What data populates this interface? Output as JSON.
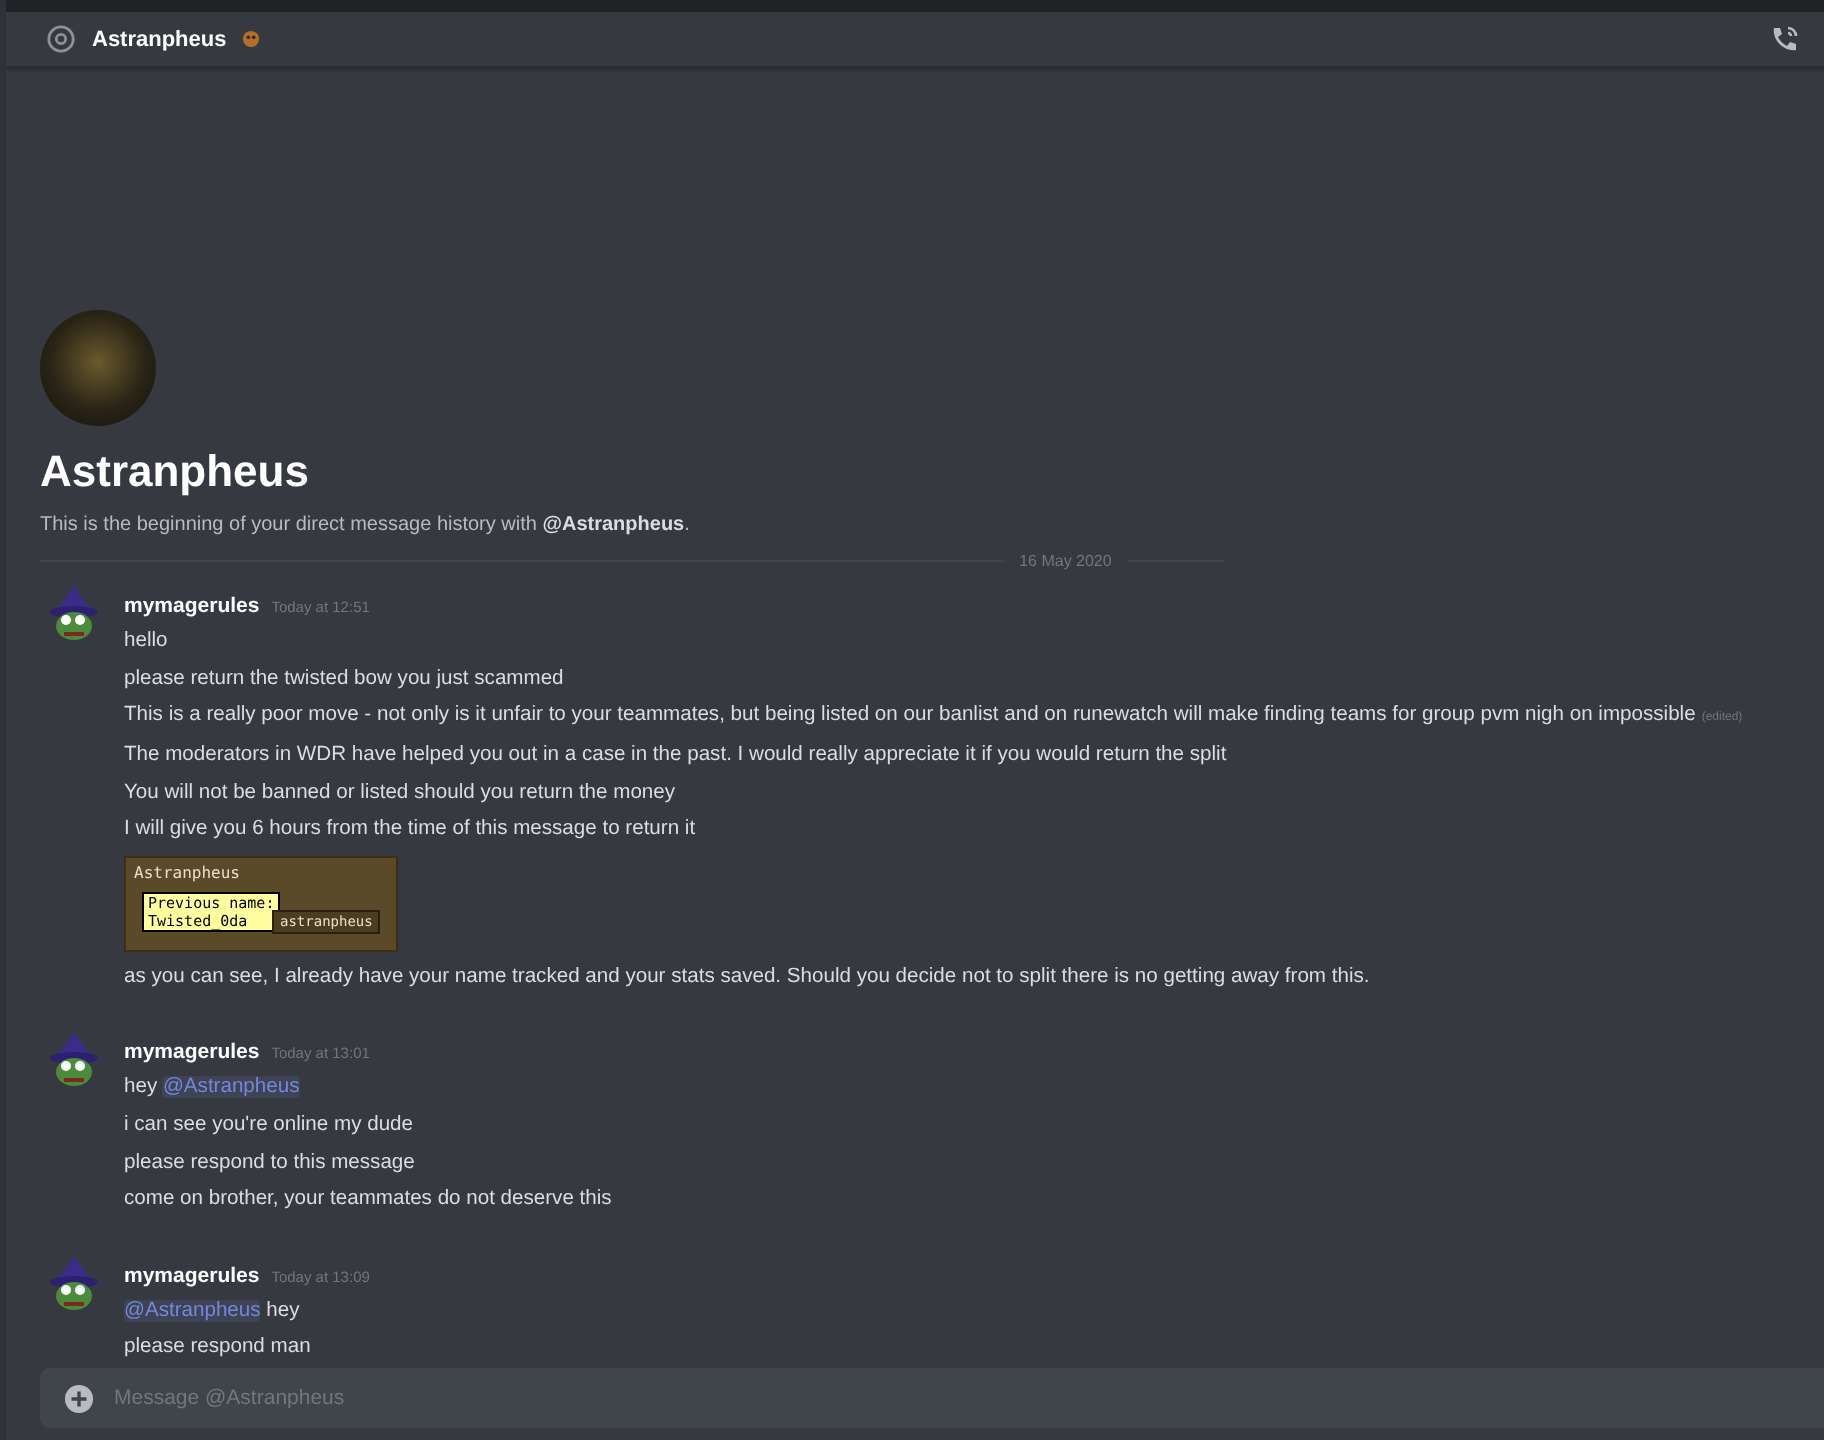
{
  "header": {
    "title": "Astranpheus"
  },
  "intro": {
    "name": "Astranpheus",
    "text": "This is the beginning of your direct message history with **@Astranpheus**."
  },
  "date_divider": "16 May 2020",
  "message_groups": [
    {
      "author": "mymagerules",
      "time": "Today at 12:51",
      "lines": [
        {
          "parts": [
            {
              "kind": "text",
              "text": "hello"
            }
          ]
        },
        {
          "parts": [
            {
              "kind": "text",
              "text": "please return the twisted bow you just scammed"
            }
          ]
        },
        {
          "parts": [
            {
              "kind": "text",
              "text": "This is a really poor move - not only is it unfair to your teammates, but being listed on our banlist and on runewatch will make finding teams for group pvm nigh on impossible"
            }
          ],
          "edited": "(edited)"
        },
        {
          "parts": [
            {
              "kind": "text",
              "text": "The moderators in WDR have helped you out in a case in the past. I would really appreciate it if you would return the split"
            }
          ]
        },
        {
          "parts": [
            {
              "kind": "text",
              "text": "You will not be banned or listed should you return the money"
            }
          ]
        },
        {
          "parts": [
            {
              "kind": "text",
              "text": "I will give you 6 hours from the time of this message to return it"
            }
          ]
        },
        {
          "attachment": {
            "name_tag": "Astranpheus",
            "tooltip_title": "Previous name:",
            "tooltip_value": "Twisted_0da",
            "button": "astranpheus"
          }
        },
        {
          "parts": [
            {
              "kind": "text",
              "text": "as you can see, I already have your name tracked and your stats saved. Should you decide not to split there is no getting away from this."
            }
          ]
        }
      ]
    },
    {
      "author": "mymagerules",
      "time": "Today at 13:01",
      "lines": [
        {
          "parts": [
            {
              "kind": "text",
              "text": "hey "
            },
            {
              "kind": "mention",
              "text": "@Astranpheus"
            }
          ]
        },
        {
          "parts": [
            {
              "kind": "text",
              "text": "i can see you're online my dude"
            }
          ]
        },
        {
          "parts": [
            {
              "kind": "text",
              "text": "please respond to this message"
            }
          ]
        },
        {
          "parts": [
            {
              "kind": "text",
              "text": "come on brother, your teammates do not deserve this"
            }
          ]
        }
      ]
    },
    {
      "author": "mymagerules",
      "time": "Today at 13:09",
      "lines": [
        {
          "parts": [
            {
              "kind": "mention",
              "text": "@Astranpheus"
            },
            {
              "kind": "text",
              "text": " hey"
            }
          ]
        },
        {
          "parts": [
            {
              "kind": "text",
              "text": "please respond man"
            }
          ]
        }
      ]
    }
  ],
  "composer": {
    "placeholder": "Message @Astranpheus"
  }
}
